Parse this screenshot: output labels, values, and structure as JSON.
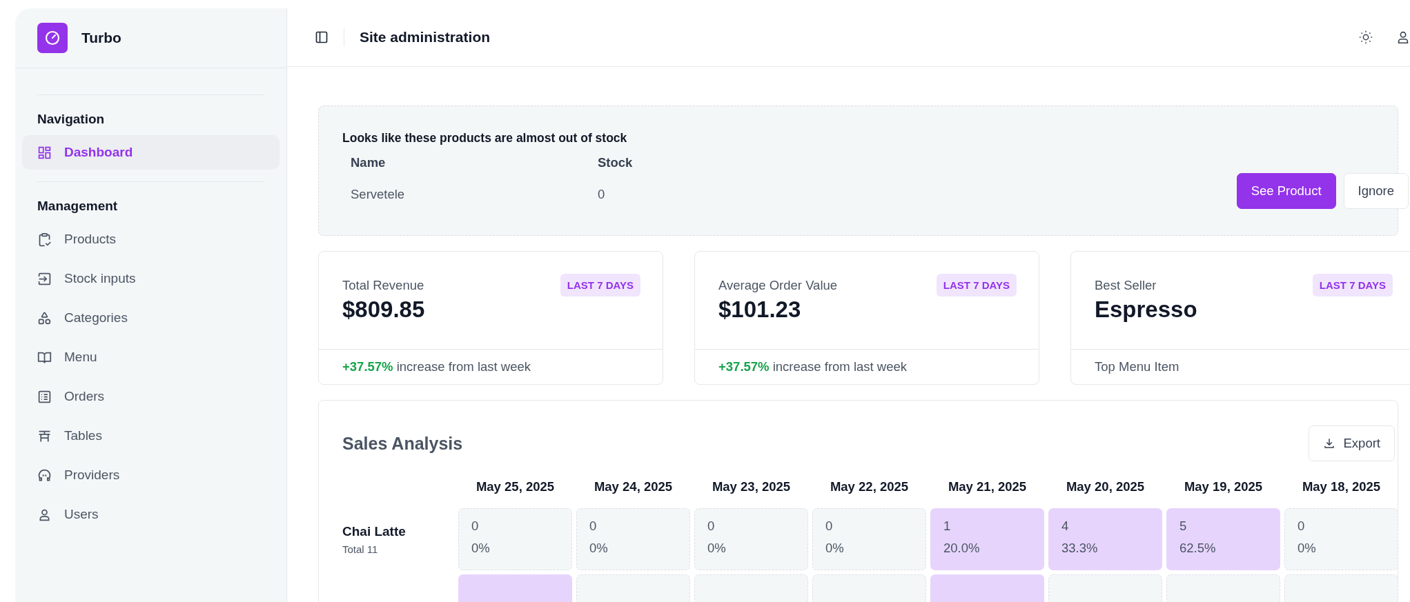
{
  "app": {
    "name": "Turbo"
  },
  "sidebar": {
    "sections": [
      {
        "title": "Navigation",
        "items": [
          {
            "label": "Dashboard",
            "kind": "dashboard",
            "selected": true
          }
        ]
      },
      {
        "title": "Management",
        "items": [
          {
            "label": "Products",
            "kind": "clipboard",
            "selected": false
          },
          {
            "label": "Stock inputs",
            "kind": "login",
            "selected": false
          },
          {
            "label": "Categories",
            "kind": "shapes",
            "selected": false
          },
          {
            "label": "Menu",
            "kind": "book",
            "selected": false
          },
          {
            "label": "Orders",
            "kind": "list",
            "selected": false
          },
          {
            "label": "Tables",
            "kind": "table",
            "selected": false
          },
          {
            "label": "Providers",
            "kind": "face",
            "selected": false
          },
          {
            "label": "Users",
            "kind": "user",
            "selected": false
          }
        ]
      }
    ]
  },
  "header": {
    "title": "Site administration"
  },
  "stock_alert": {
    "message": "Looks like these products are almost out of stock",
    "columns": [
      "Name",
      "Stock"
    ],
    "rows": [
      {
        "name": "Servetele",
        "stock": "0"
      }
    ],
    "buttons": [
      {
        "label": "See Product",
        "kind": "primary"
      },
      {
        "label": "Ignore",
        "kind": "secondary"
      }
    ]
  },
  "cards": [
    {
      "title": "Total Revenue",
      "badge": "LAST 7 DAYS",
      "value": "$809.85",
      "change": "+37.57%",
      "footer": "increase from last week"
    },
    {
      "title": "Average Order Value",
      "badge": "LAST 7 DAYS",
      "value": "$101.23",
      "change": "+37.57%",
      "footer": "increase from last week"
    },
    {
      "title": "Best Seller",
      "badge": "LAST 7 DAYS",
      "value": "Espresso",
      "footer": "Top Menu Item"
    }
  ],
  "sales_analysis": {
    "title": "Sales Analysis",
    "export_button": "Export",
    "columns": [
      "May 25, 2025",
      "May 24, 2025",
      "May 23, 2025",
      "May 22, 2025",
      "May 21, 2025",
      "May 20, 2025",
      "May 19, 2025",
      "May 18, 2025"
    ],
    "rows": [
      {
        "name": "Chai Latte",
        "total": "Total 11",
        "cells": [
          {
            "count": "0",
            "percent": "0%",
            "highlighted": false
          },
          {
            "count": "0",
            "percent": "0%",
            "highlighted": false
          },
          {
            "count": "0",
            "percent": "0%",
            "highlighted": false
          },
          {
            "count": "0",
            "percent": "0%",
            "highlighted": false
          },
          {
            "count": "1",
            "percent": "20.0%",
            "highlighted": true
          },
          {
            "count": "4",
            "percent": "33.3%",
            "highlighted": true
          },
          {
            "count": "5",
            "percent": "62.5%",
            "highlighted": true
          },
          {
            "count": "0",
            "percent": "0%",
            "highlighted": false
          }
        ]
      },
      {
        "cells": [
          {
            "highlighted": true
          },
          {
            "highlighted": false
          },
          {
            "highlighted": false
          },
          {
            "highlighted": false
          },
          {
            "highlighted": true
          },
          {
            "highlighted": false
          },
          {
            "highlighted": false
          },
          {
            "highlighted": false
          }
        ]
      }
    ]
  }
}
